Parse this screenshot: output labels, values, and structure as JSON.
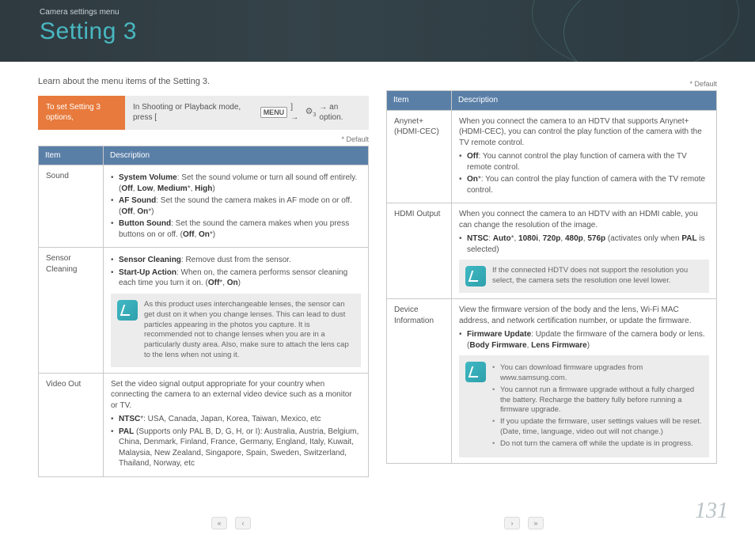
{
  "header": {
    "breadcrumb": "Camera settings menu",
    "title": "Setting 3"
  },
  "intro": "Learn about the menu items of the Setting 3.",
  "default_marker": "* Default",
  "lead": {
    "label": "To set Setting 3 options,",
    "instruction_prefix": "In Shooting or Playback mode, press [",
    "menu_label": "MENU",
    "instruction_mid": "] → ",
    "instruction_suffix": " → an option."
  },
  "table_headers": {
    "item": "Item",
    "desc": "Description"
  },
  "left_rows": {
    "sound": {
      "item": "Sound",
      "b1a": "System Volume",
      "b1b": ": Set the sound volume or turn all sound off entirely. (",
      "b1c": "Off",
      "b1d": ", ",
      "b1e": "Low",
      "b1f": ", ",
      "b1g": "Medium",
      "b1h": "*, ",
      "b1i": "High",
      "b1j": ")",
      "b2a": "AF Sound",
      "b2b": ": Set the sound the camera makes in AF mode on or off. (",
      "b2c": "Off",
      "b2d": ", ",
      "b2e": "On",
      "b2f": "*)",
      "b3a": "Button Sound",
      "b3b": ": Set the sound the camera makes when you press buttons on or off. (",
      "b3c": "Off",
      "b3d": ", ",
      "b3e": "On",
      "b3f": "*)"
    },
    "sensor": {
      "item": "Sensor Cleaning",
      "b1a": "Sensor Cleaning",
      "b1b": ": Remove dust from the sensor.",
      "b2a": "Start-Up Action",
      "b2b": ": When on, the camera performs sensor cleaning each time you turn it on. (",
      "b2c": "Off",
      "b2d": "*, ",
      "b2e": "On",
      "b2f": ")",
      "note": "As this product uses interchangeable lenses, the sensor can get dust on it when you change lenses. This can lead to dust particles appearing in the photos you capture. It is recommended not to change lenses when you are in a particularly dusty area. Also, make sure to attach the lens cap to the lens when not using it."
    },
    "video": {
      "item": "Video Out",
      "p1": "Set the video signal output appropriate for your country when connecting the camera to an external video device such as a monitor or TV.",
      "b1a": "NTSC",
      "b1b": "*: USA, Canada, Japan, Korea, Taiwan, Mexico, etc",
      "b2a": "PAL",
      "b2b": " (Supports only PAL B, D, G, H, or I): Australia, Austria, Belgium, China, Denmark, Finland, France, Germany, England, Italy, Kuwait, Malaysia, New Zealand, Singapore, Spain, Sweden, Switzerland, Thailand, Norway, etc"
    }
  },
  "right_rows": {
    "anynet": {
      "item": "Anynet+ (HDMI-CEC)",
      "p1": "When you connect the camera to an HDTV that supports Anynet+ (HDMI-CEC), you can control the play function of the camera with the TV remote control.",
      "b1a": "Off",
      "b1b": ": You cannot control the play function of camera with the TV remote control.",
      "b2a": "On",
      "b2b": "*: You can control the play function of camera with the TV remote control."
    },
    "hdmi": {
      "item": "HDMI Output",
      "p1": "When you connect the camera to an HDTV with an HDMI cable, you can change the resolution of the image.",
      "b1a": "NTSC",
      "b1b": ": ",
      "b1c": "Auto",
      "b1d": "*, ",
      "b1e": "1080i",
      "b1f": ", ",
      "b1g": "720p",
      "b1h": ", ",
      "b1i": "480p",
      "b1j": ", ",
      "b1k": "576p",
      "b1l": " (activates only when ",
      "b1m": "PAL",
      "b1n": " is selected)",
      "note": "If the connected HDTV does not support the resolution you select, the camera sets the resolution one level lower."
    },
    "device": {
      "item": "Device Information",
      "p1": "View the firmware version of the body and the lens, Wi-Fi MAC address, and network certification number, or update the firmware.",
      "b1a": "Firmware Update",
      "b1b": ": Update the firmware of the camera body or lens. (",
      "b1c": "Body Firmware",
      "b1d": ", ",
      "b1e": "Lens Firmware",
      "b1f": ")",
      "n1": "You can download firmware upgrades from www.samsung.com.",
      "n2": "You cannot run a firmware upgrade without a fully charged the battery. Recharge the battery fully before running a firmware upgrade.",
      "n3": "If you update the firmware, user settings values will be reset. (Date, time, language, video out will not change.)",
      "n4": "Do not turn the camera off while the update is in progress."
    }
  },
  "page_number": "131"
}
